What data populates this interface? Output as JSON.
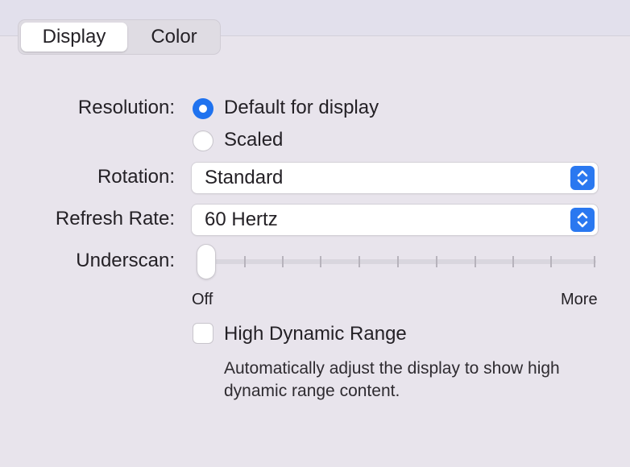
{
  "tabs": [
    {
      "label": "Display",
      "active": true
    },
    {
      "label": "Color",
      "active": false
    }
  ],
  "resolution": {
    "label": "Resolution:",
    "options": [
      {
        "label": "Default for display",
        "selected": true
      },
      {
        "label": "Scaled",
        "selected": false
      }
    ]
  },
  "rotation": {
    "label": "Rotation:",
    "value": "Standard"
  },
  "refresh_rate": {
    "label": "Refresh Rate:",
    "value": "60 Hertz"
  },
  "underscan": {
    "label": "Underscan:",
    "min_label": "Off",
    "max_label": "More",
    "value": 0
  },
  "hdr": {
    "label": "High Dynamic Range",
    "checked": false,
    "description": "Automatically adjust the display to show high dynamic range content."
  },
  "colors": {
    "accent": "#1f72ef",
    "background": "#e8e4ec"
  }
}
